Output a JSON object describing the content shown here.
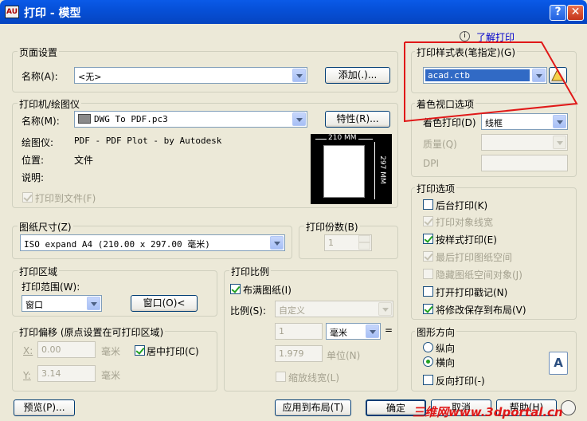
{
  "window": {
    "title": "打印 - 模型",
    "icon_label": "AU",
    "help": "?",
    "close": "✕"
  },
  "learn_link": "了解打印",
  "page_setup": {
    "group": "页面设置",
    "name_label": "名称(A):",
    "name_value": "<无>",
    "add_button": "添加(.)..."
  },
  "printer": {
    "group": "打印机/绘图仪",
    "name_label": "名称(M):",
    "name_value": "DWG To PDF.pc3",
    "properties_button": "特性(R)...",
    "plotter_label": "绘图仪:",
    "plotter_value": "PDF - PDF Plot - by Autodesk",
    "location_label": "位置:",
    "location_value": "文件",
    "description_label": "说明:",
    "print_to_file": "打印到文件(F)",
    "preview_width": "210 MM",
    "preview_height": "297 MM"
  },
  "paper_size": {
    "group": "图纸尺寸(Z)",
    "value": "ISO expand A4 (210.00 x 297.00 毫米)"
  },
  "copies": {
    "group": "打印份数(B)",
    "value": "1"
  },
  "plot_area": {
    "group": "打印区域",
    "range_label": "打印范围(W):",
    "range_value": "窗口",
    "window_button": "窗口(O)<"
  },
  "plot_offset": {
    "group": "打印偏移 (原点设置在可打印区域)",
    "x_label": "X:",
    "x_value": "0.00",
    "x_unit": "毫米",
    "y_label": "Y:",
    "y_value": "3.14",
    "y_unit": "毫米",
    "center": "居中打印(C)"
  },
  "plot_scale": {
    "group": "打印比例",
    "fit_paper": "布满图纸(I)",
    "scale_label": "比例(S):",
    "scale_value": "自定义",
    "value1": "1",
    "unit_value": "毫米",
    "equals": "=",
    "value2": "1.979",
    "unit_label": "单位(N)",
    "scale_lineweights": "缩放线宽(L)"
  },
  "style_table": {
    "group": "打印样式表(笔指定)(G)",
    "value": "acad.ctb"
  },
  "shaded_viewport": {
    "group": "着色视口选项",
    "shade_label": "着色打印(D)",
    "shade_value": "线框",
    "quality_label": "质量(Q)",
    "dpi_label": "DPI"
  },
  "plot_options": {
    "group": "打印选项",
    "items": [
      {
        "label": "后台打印(K)",
        "checked": false,
        "enabled": true
      },
      {
        "label": "打印对象线宽",
        "checked": true,
        "enabled": false
      },
      {
        "label": "按样式打印(E)",
        "checked": true,
        "enabled": true
      },
      {
        "label": "最后打印图纸空间",
        "checked": true,
        "enabled": false
      },
      {
        "label": "隐藏图纸空间对象(J)",
        "checked": false,
        "enabled": false
      },
      {
        "label": "打开打印戳记(N)",
        "checked": false,
        "enabled": true
      },
      {
        "label": "将修改保存到布局(V)",
        "checked": true,
        "enabled": true
      }
    ]
  },
  "orientation": {
    "group": "图形方向",
    "portrait": "纵向",
    "landscape": "横向",
    "reverse": "反向打印(-)",
    "icon_letter": "A"
  },
  "buttons": {
    "preview": "预览(P)...",
    "apply_layout": "应用到布局(T)",
    "ok": "确定",
    "cancel": "取消",
    "help": "帮助(H)"
  },
  "watermark": "三维网www.3dportal.cn",
  "colors": {
    "title_bar": "#0650d8",
    "dialog_bg": "#ece9d8",
    "selection": "#316ac5",
    "annotation": "#e01818"
  }
}
